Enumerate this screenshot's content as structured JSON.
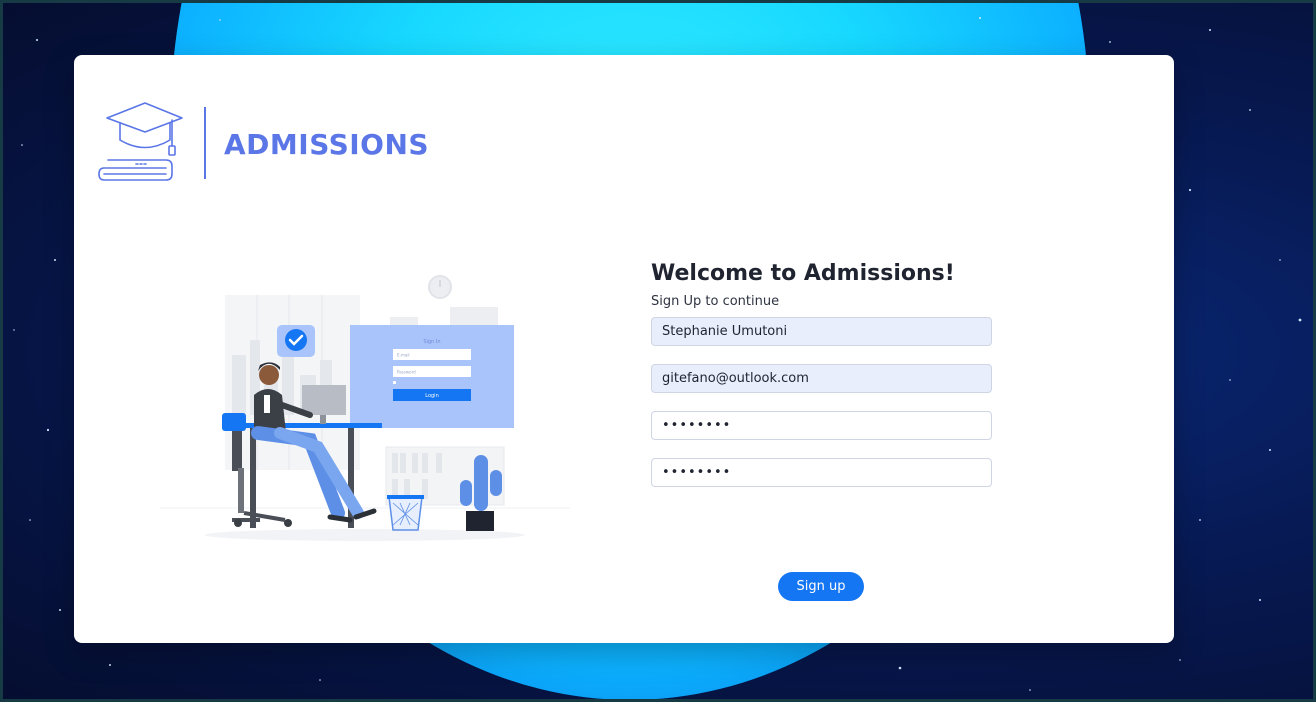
{
  "brand": {
    "title": "ADMISSIONS",
    "logo_icon": "graduation-cap-book-icon",
    "accent_color": "#5b76e6"
  },
  "form": {
    "welcome": "Welcome to Admissions!",
    "subtitle": "Sign Up to continue",
    "name_value": "Stephanie Umutoni",
    "email_value": "gitefano@outlook.com",
    "password_value": "••••••••",
    "confirm_password_value": "••••••••",
    "signup_label": "Sign up",
    "button_color": "#1476f2"
  },
  "illustration": {
    "name": "person-at-desk-signin-illustration",
    "signin_title": "Sign In",
    "email_placeholder": "E-mail",
    "password_placeholder": "Password",
    "login_label": "Login"
  }
}
